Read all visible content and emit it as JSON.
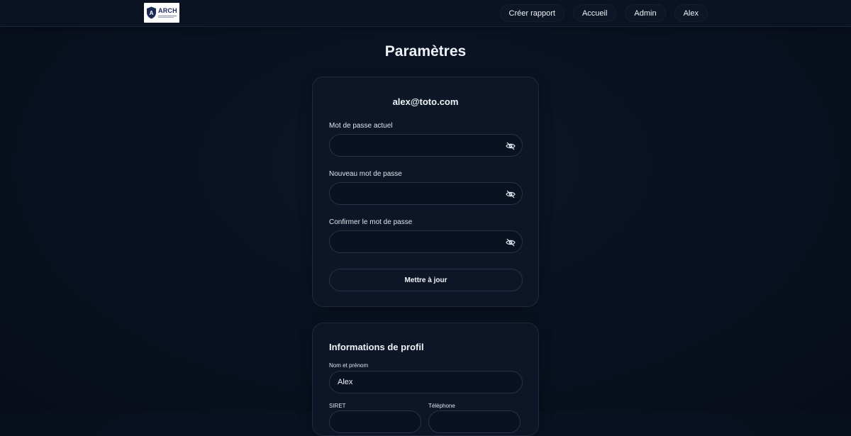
{
  "header": {
    "logo_text": "ARCH",
    "nav": [
      {
        "label": "Créer rapport"
      },
      {
        "label": "Accueil"
      },
      {
        "label": "Admin"
      },
      {
        "label": "Alex"
      }
    ]
  },
  "page": {
    "title": "Paramètres"
  },
  "password_card": {
    "email": "alex@toto.com",
    "current_password_label": "Mot de passe actuel",
    "current_password_value": "",
    "new_password_label": "Nouveau mot de passe",
    "new_password_value": "",
    "confirm_password_label": "Confirmer le mot de passe",
    "confirm_password_value": "",
    "update_button": "Mettre à jour"
  },
  "profile_card": {
    "title": "Informations de profil",
    "name_label": "Nom et prénom",
    "name_value": "Alex",
    "siret_label": "SIRET",
    "phone_label": "Téléphone"
  },
  "icons": {
    "toggle_visibility": "eye-off-icon",
    "logo": "shield-icon"
  },
  "colors": {
    "background": "#091120",
    "card": "#0d1626",
    "border": "#263247",
    "text": "#eef1f6"
  }
}
